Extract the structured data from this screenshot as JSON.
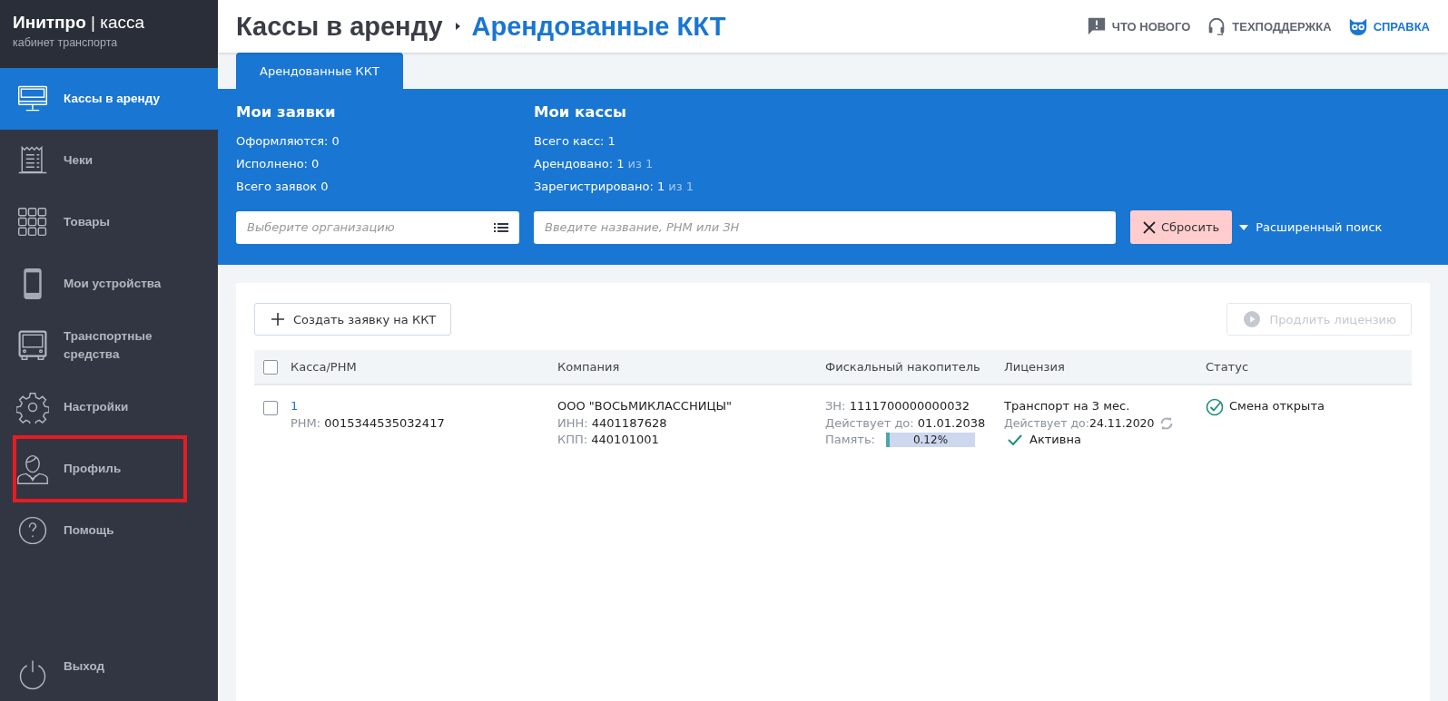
{
  "brand": {
    "name": "Инитпро",
    "separator": "|",
    "product": "касса",
    "subtitle": "кабинет транспорта"
  },
  "sidebar": {
    "items": [
      {
        "kind": "monitor",
        "label": "Кассы в аренду",
        "selected": true,
        "highlighted": false
      },
      {
        "kind": "receipt",
        "label": "Чеки",
        "selected": false,
        "highlighted": false
      },
      {
        "kind": "grid",
        "label": "Товары",
        "selected": false,
        "highlighted": false
      },
      {
        "kind": "phone",
        "label": "Мои устройства",
        "selected": false,
        "highlighted": false
      },
      {
        "kind": "bus",
        "label": "Транспортные средства",
        "selected": false,
        "highlighted": false
      },
      {
        "kind": "gear",
        "label": "Настройки",
        "selected": false,
        "highlighted": false
      },
      {
        "kind": "user",
        "label": "Профиль",
        "selected": false,
        "highlighted": true
      },
      {
        "kind": "help",
        "label": "Помощь",
        "selected": false,
        "highlighted": false
      }
    ],
    "logout": "Выход"
  },
  "header": {
    "breadcrumb": [
      "Кассы в аренду",
      "Арендованные ККТ"
    ],
    "links": [
      {
        "kind": "news",
        "label": "ЧТО НОВОГО"
      },
      {
        "kind": "support",
        "label": "ТЕХПОДДЕРЖКА"
      },
      {
        "kind": "help",
        "label": "СПРАВКА"
      }
    ]
  },
  "tabs": [
    {
      "label": "Арендованные ККТ",
      "selected": true
    }
  ],
  "summary": [
    {
      "title": "Мои заявки",
      "lines": [
        {
          "label": "Оформляются:",
          "value": "0"
        },
        {
          "label": "Исполнено:",
          "value": "0"
        },
        {
          "label": "Всего заявок",
          "value": "0"
        }
      ]
    },
    {
      "title": "Мои кассы",
      "lines": [
        {
          "label": "Всего касс:",
          "value": "1"
        },
        {
          "label": "Арендовано:",
          "value": "1",
          "of": "из 1"
        },
        {
          "label": "Зарегистрировано:",
          "value": "1",
          "of": "из 1"
        }
      ]
    }
  ],
  "filters": {
    "organization": {
      "placeholder": "Выберите организацию"
    },
    "search": {
      "placeholder": "Введите название, РНМ или ЗН"
    },
    "reset": "Сбросить",
    "advanced": "Расширенный поиск"
  },
  "toolbar": {
    "create": "Создать заявку на ККТ",
    "extend": {
      "label": "Продлить лицензию",
      "disabled": true
    }
  },
  "table": {
    "columns": [
      "Касса/РНМ",
      "Компания",
      "Фискальный накопитель",
      "Лицензия",
      "Статус"
    ],
    "all_checked": false,
    "rows": [
      {
        "checked": false,
        "number": "1",
        "rnm_label": "РНМ:",
        "rnm": "0015344535032417",
        "company": "ООО \"ВОСЬМИКЛАССНИЦЫ\"",
        "inn_label": "ИНН:",
        "inn": "4401187628",
        "kpp_label": "КПП:",
        "kpp": "440101001",
        "zn_label": "ЗН:",
        "zn": "1111700000000032",
        "fn_until_label": "Действует до:",
        "fn_until": "01.01.2038",
        "memory_label": "Память:",
        "memory": "0.12%",
        "level": 0.0012,
        "license": "Транспорт на 3 мес.",
        "license_until_label": "Действует до:",
        "license_until": "24.11.2020",
        "license_state": "Активна",
        "license_active": true,
        "status": "Смена открыта",
        "status_ok": true
      }
    ]
  }
}
